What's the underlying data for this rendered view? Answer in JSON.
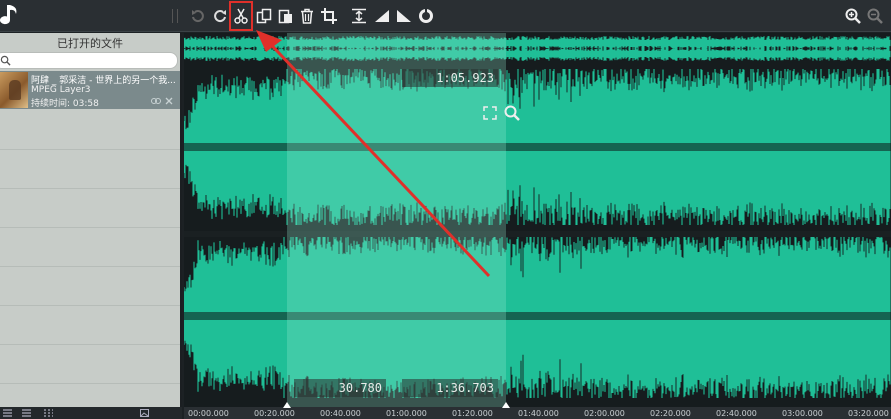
{
  "toolbar": {
    "buttons": [
      "undo-icon",
      "redo-icon",
      "scissors-icon",
      "copy-icon",
      "paste-icon",
      "trash-icon",
      "crop-icon",
      "normalize-icon",
      "fade-in-icon",
      "fade-out-icon",
      "effects-icon",
      "zoom-in-icon",
      "zoom-out-icon"
    ],
    "accent_color": "#e0302a"
  },
  "sidebar": {
    "title": "已打开的文件",
    "search": {
      "value": "",
      "placeholder": ""
    },
    "files": [
      {
        "name": "阿肆 _ 郭采洁 - 世界上的另一个我...",
        "format": "MPEG Layer3",
        "duration": "持续时间: 03:58"
      }
    ]
  },
  "waveform": {
    "color": "#1fbf97",
    "selection_start": "30.780",
    "selection_end": "1:36.703",
    "current_position": "1:05.923"
  },
  "timeline": {
    "ticks": [
      "00:00.000",
      "00:20.000",
      "00:40.000",
      "01:00.000",
      "01:20.000",
      "01:40.000",
      "02:00.000",
      "02:20.000",
      "02:40.000",
      "03:00.000",
      "03:20.000"
    ]
  }
}
